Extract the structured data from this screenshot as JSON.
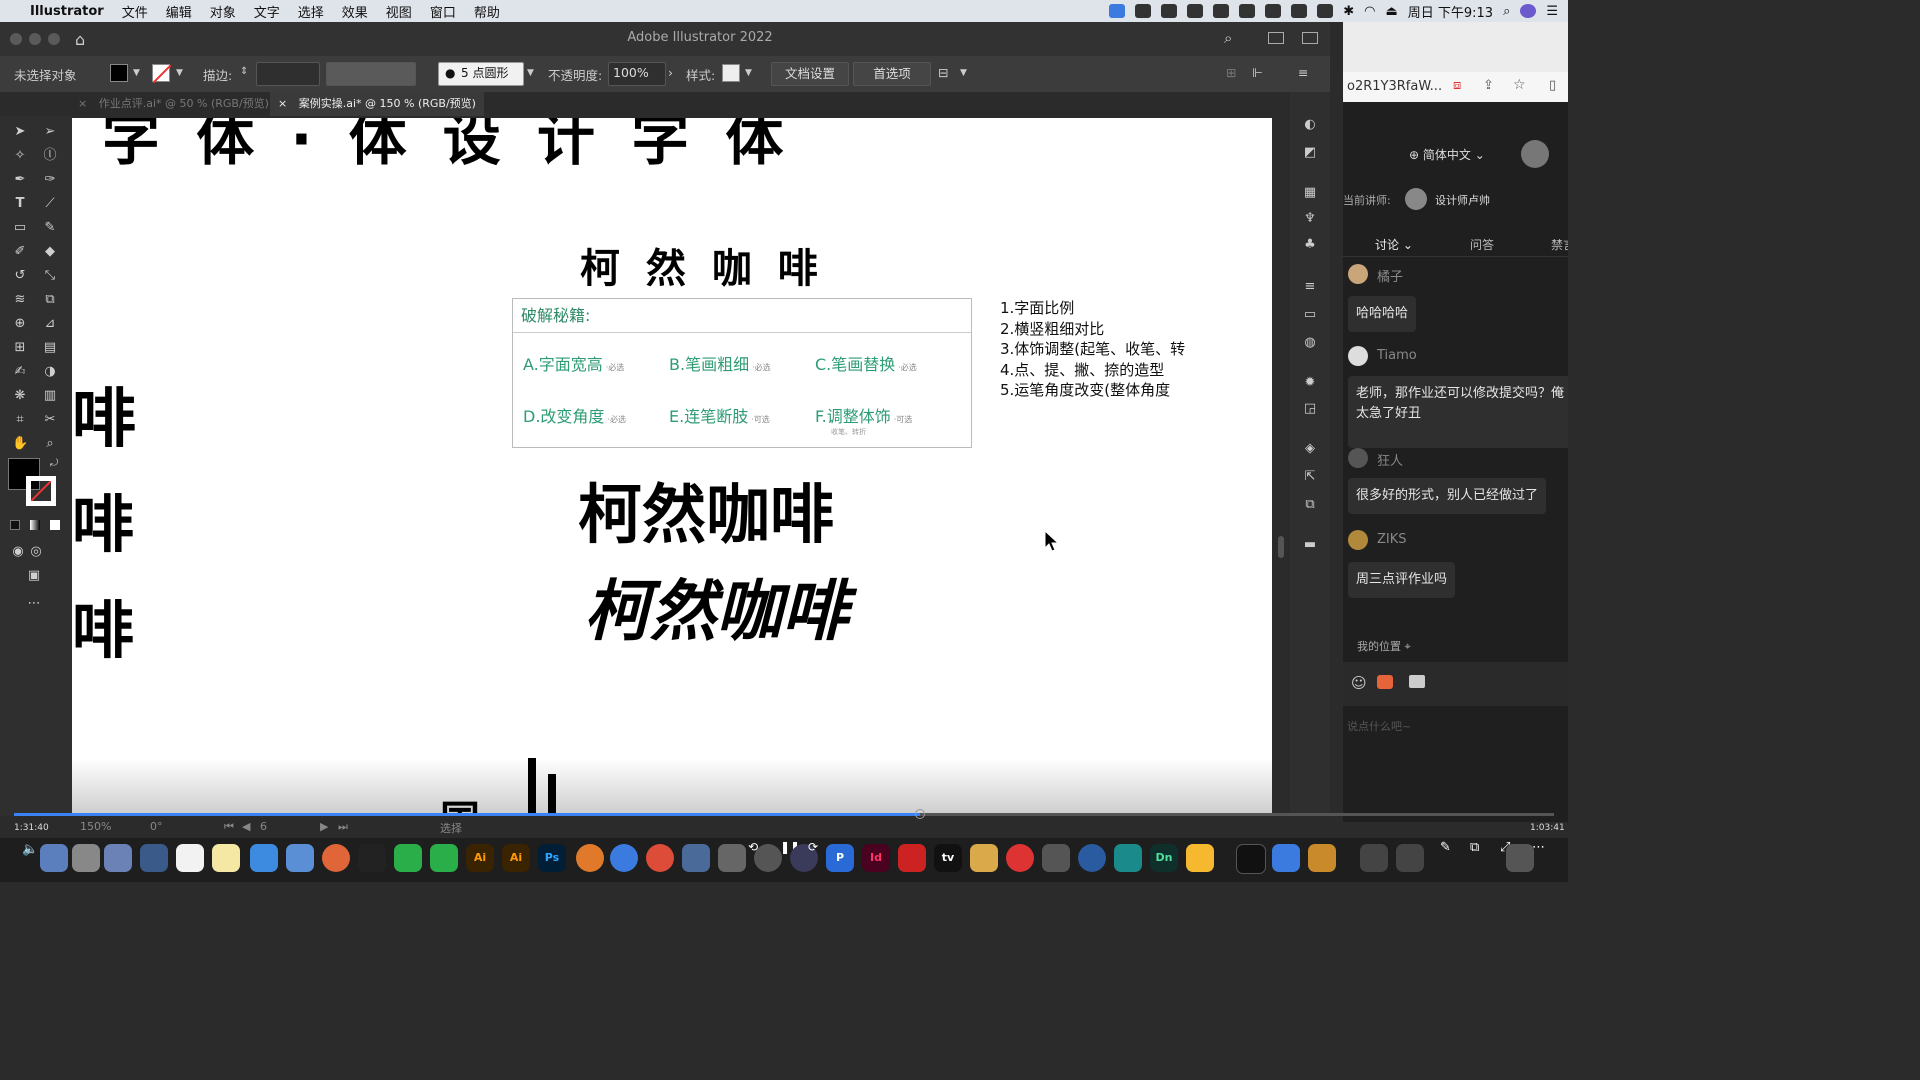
{
  "menubar": {
    "app_name": "Illustrator",
    "items": [
      "文件",
      "编辑",
      "对象",
      "文字",
      "选择",
      "效果",
      "视图",
      "窗口",
      "帮助"
    ],
    "clock": "周日 下午9:13"
  },
  "window": {
    "title": "Adobe Illustrator 2022"
  },
  "controlbar": {
    "selection": "未选择对象",
    "stroke_label": "描边:",
    "brush": "5 点圆形",
    "opacity_label": "不透明度:",
    "opacity_value": "100%",
    "style_label": "样式:",
    "doc_settings": "文档设置",
    "preferences": "首选项"
  },
  "tabs": [
    {
      "label": "作业点评.ai* @ 50 % (RGB/预览)",
      "active": false
    },
    {
      "label": "案例实操.ai* @ 150 % (RGB/预览)",
      "active": true
    }
  ],
  "canvas": {
    "top_title": "字 体 · 体 设 计 字 体",
    "heading_outline": "柯 然 咖 啡",
    "tips_header": "破解秘籍:",
    "tips": [
      {
        "label": "A.字面宽高",
        "tag": "·必选"
      },
      {
        "label": "B.笔画粗细",
        "tag": "·必选"
      },
      {
        "label": "C.笔画替换",
        "tag": "·必选"
      },
      {
        "label": "D.改变角度",
        "tag": "·必选"
      },
      {
        "label": "E.连笔断肢",
        "tag": "·可选"
      },
      {
        "label": "F.调整体饰",
        "tag": "·可选"
      }
    ],
    "tip_subnote": "收笔、转折",
    "notes": [
      "1.字面比例",
      "2.横竖粗细对比",
      "3.体饰调整(起笔、收笔、转",
      "4.点、提、撇、捺的造型",
      "5.运笔角度改变(整体角度"
    ],
    "word_regular": "柯然咖啡",
    "word_italic": "柯然咖啡",
    "left_glyph": "啡",
    "bottom_glyph": "国"
  },
  "statusbar": {
    "zoom": "150%",
    "angle": "0°",
    "artboard": "6",
    "mode": "选择"
  },
  "browser": {
    "url": "o2R1Y3RfaW...",
    "language": "简体中文",
    "presenter_label": "当前讲师:",
    "presenter_name": "设计师卢帅",
    "chat_tabs": [
      "讨论",
      "问答",
      "禁言"
    ],
    "messages": [
      {
        "user": "橘子",
        "text": "哈哈哈哈"
      },
      {
        "user": "Tiamo",
        "text": "老师，那作业还可以修改提交吗？俺太急了好丑"
      },
      {
        "user": "狂人",
        "text": "很多好的形式，别人已经做过了"
      },
      {
        "user": "ZIKS",
        "text": "周三点评作业吗"
      }
    ],
    "location": "我的位置",
    "input_placeholder": "说点什么吧~"
  },
  "video": {
    "elapsed": "1:31:40",
    "total": "1:03:41",
    "progress": 0.6
  },
  "dock_icons": [
    "Ai",
    "Ai",
    "Ps",
    "P",
    "Id",
    "tv",
    "Dn"
  ]
}
